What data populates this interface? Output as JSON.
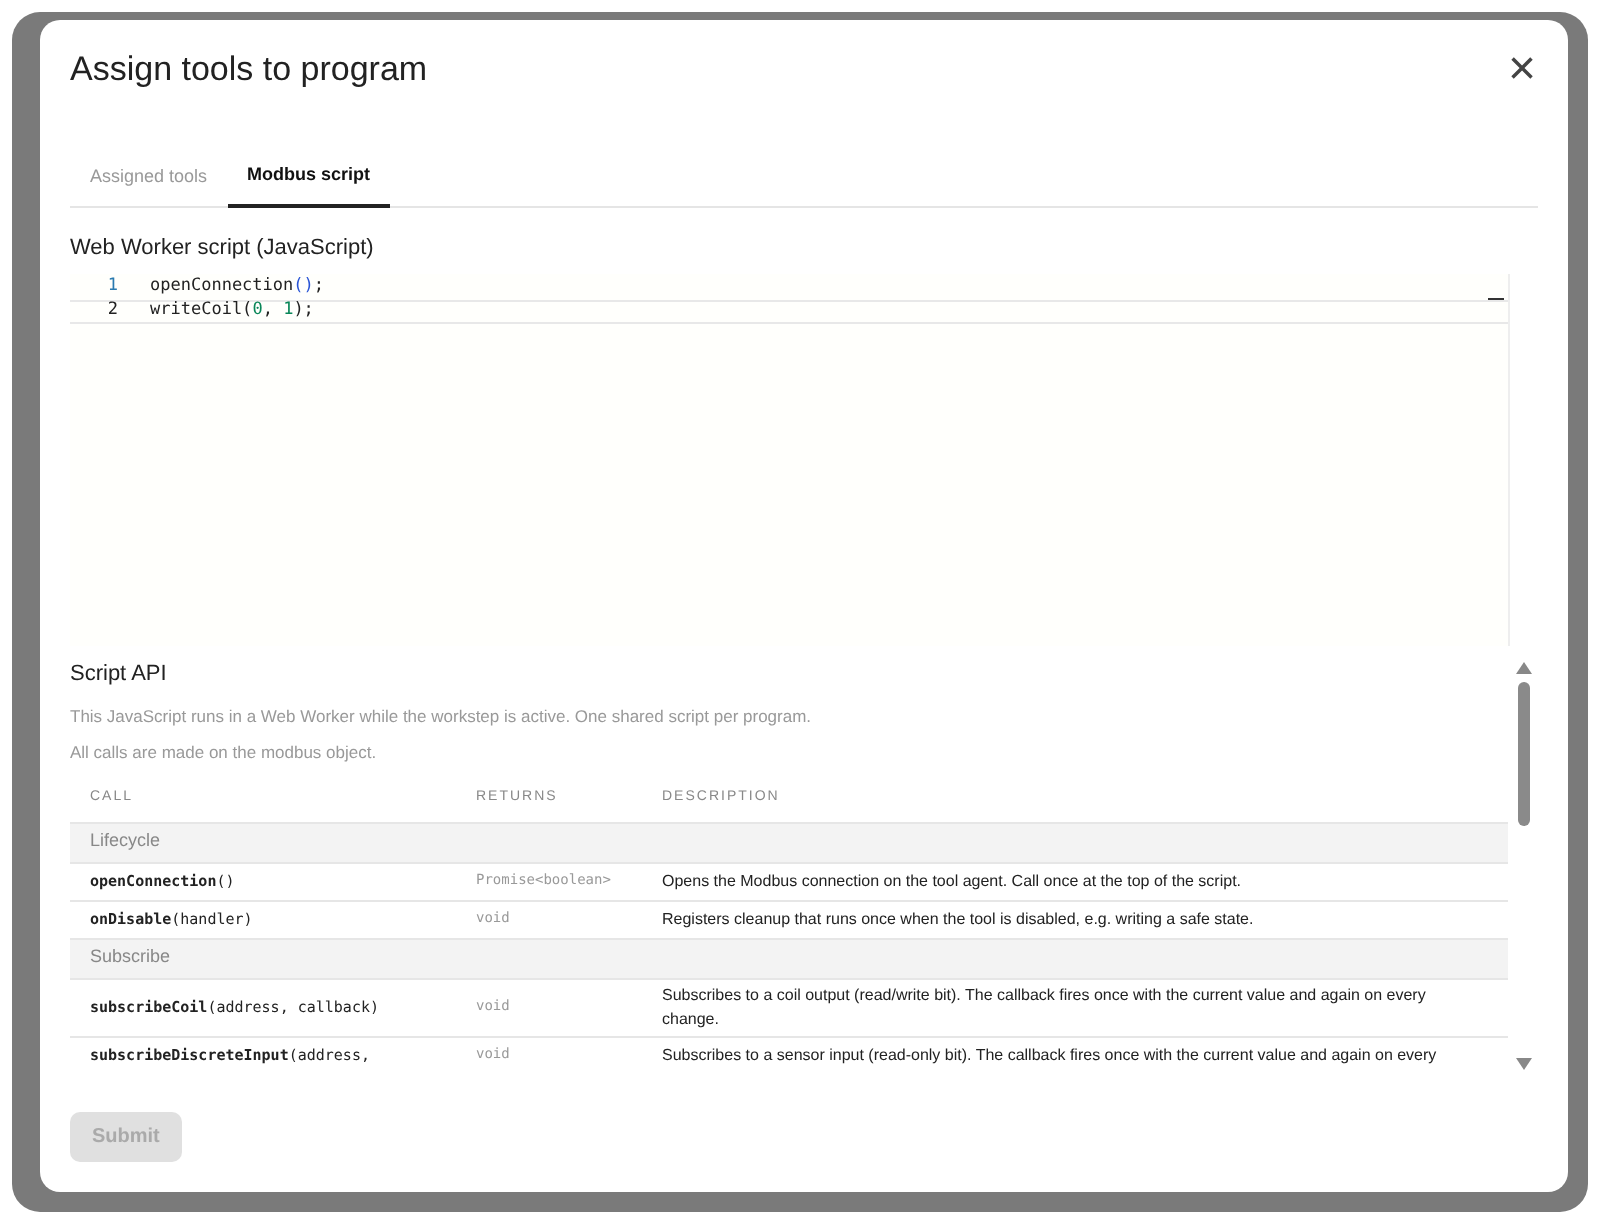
{
  "dialog": {
    "title": "Assign tools to program",
    "close_label": "×"
  },
  "tabs": [
    {
      "label": "Assigned tools",
      "selected": false
    },
    {
      "label": "Modbus script",
      "selected": true
    }
  ],
  "editor": {
    "label": "Web Worker script (JavaScript)",
    "lines": [
      {
        "number": "1",
        "tokens": [
          {
            "kind": "ident",
            "text": "openConnection"
          },
          {
            "kind": "punct",
            "text": "()"
          },
          {
            "kind": "plain",
            "text": ";"
          }
        ]
      },
      {
        "number": "2",
        "tokens": [
          {
            "kind": "ident",
            "text": "writeCoil("
          },
          {
            "kind": "number",
            "text": "0"
          },
          {
            "kind": "plain",
            "text": ", "
          },
          {
            "kind": "number",
            "text": "1"
          },
          {
            "kind": "plain",
            "text": ");"
          }
        ]
      }
    ]
  },
  "api": {
    "title": "Script API",
    "notes": [
      "This JavaScript runs in a Web Worker while the workstep is active. One shared script per program.",
      "All calls are made on the modbus object."
    ],
    "columns": [
      "CALL",
      "RETURNS",
      "DESCRIPTION"
    ],
    "rows": [
      {
        "kind": "group",
        "label": "Lifecycle"
      },
      {
        "kind": "call",
        "call": "**openConnection**()",
        "returns": "Promise<boolean>",
        "description": "Opens the Modbus connection on the tool agent. Call once at the top of the script."
      },
      {
        "kind": "call",
        "call": "**onDisable**(handler)",
        "returns": "void",
        "description": "Registers cleanup that runs once when the tool is disabled, e.g. writing a safe state."
      },
      {
        "kind": "group",
        "label": "Subscribe"
      },
      {
        "kind": "call",
        "call": "**subscribeCoil**(address, callback)",
        "returns": "void",
        "description": "Subscribes to a coil output (read/write bit). The callback fires once with the current value and again on every change."
      },
      {
        "kind": "call",
        "call": "**subscribeDiscreteInput**(address,",
        "returns": "void",
        "description": "Subscribes to a sensor input (read-only bit). The callback fires once with the current value and again on every"
      }
    ]
  },
  "submit": {
    "label": "Submit",
    "disabled": true
  }
}
